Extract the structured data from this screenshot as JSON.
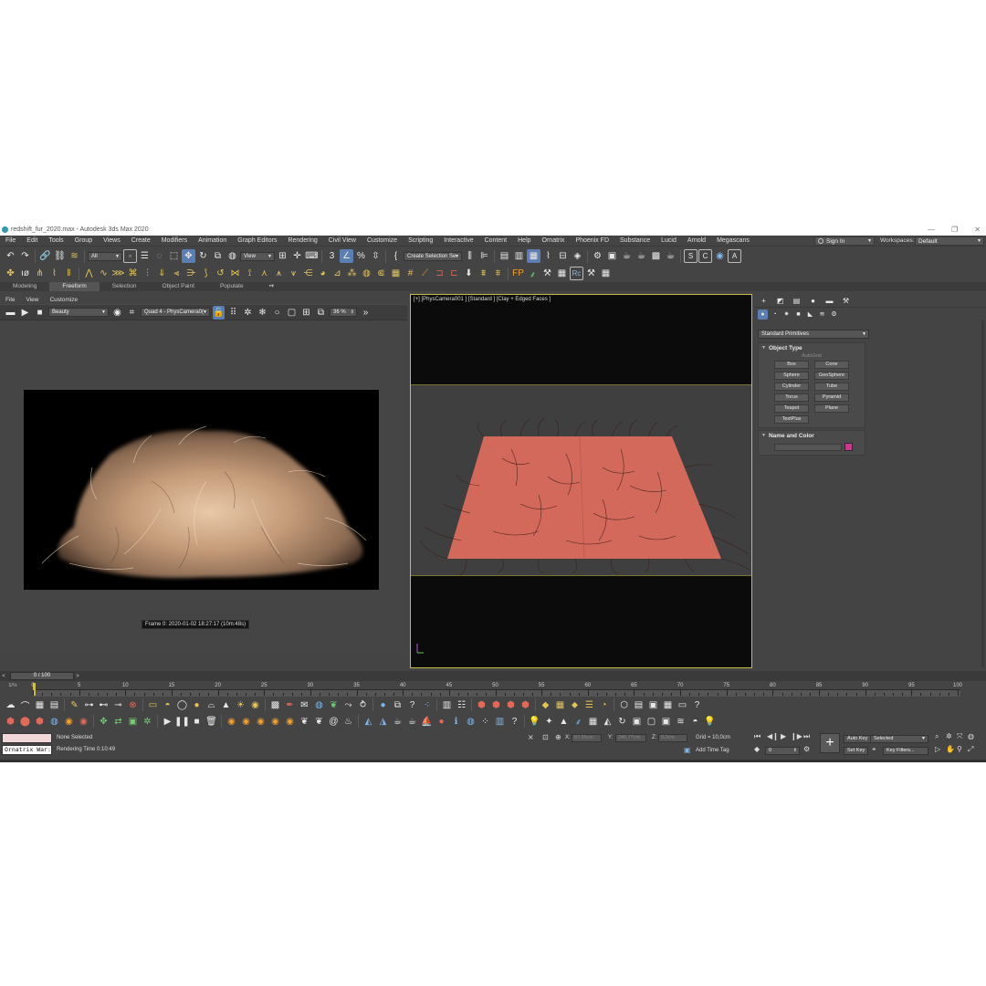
{
  "window": {
    "title": "redshift_fur_2020.max - Autodesk 3ds Max 2020",
    "controls": [
      "—",
      "❐",
      "✕"
    ]
  },
  "menubar": {
    "items": [
      "File",
      "Edit",
      "Tools",
      "Group",
      "Views",
      "Create",
      "Modifiers",
      "Animation",
      "Graph Editors",
      "Rendering",
      "Civil View",
      "Customize",
      "Scripting",
      "Interactive",
      "Content",
      "Help",
      "Ornatrix",
      "Phoenix FD",
      "Substance",
      "Lucid",
      "Arnold",
      "Megascans"
    ],
    "sign_in": "Sign In",
    "workspaces_label": "Workspaces:",
    "workspace_value": "Default"
  },
  "main_toolbar": {
    "filter_value": "All",
    "refcoord_value": "View",
    "selection_set_placeholder": "Create Selection Se"
  },
  "ribbon": {
    "tabs": [
      "Modeling",
      "Freeform",
      "Selection",
      "Object Paint",
      "Populate"
    ],
    "active": "Freeform"
  },
  "render_frame": {
    "menu": [
      "File",
      "View",
      "Customize"
    ],
    "channel_value": "Beauty",
    "view_value": "Quad 4 - PhysCamera0(",
    "zoom_value": "36 %",
    "frame_label": "Frame  0:  2020-01-02  18:27:17  (10m:48s)"
  },
  "viewport": {
    "label": "[+] [PhysCamera001 ] [Standard ] [Clay + Edged Faces ]"
  },
  "command_panel": {
    "category_value": "Standard Primitives",
    "object_type_title": "Object Type",
    "autogrid_label": "AutoGrid",
    "primitives": [
      "Box",
      "Cone",
      "Sphere",
      "GeoSphere",
      "Cylinder",
      "Tube",
      "Torus",
      "Pyramid",
      "Teapot",
      "Plane",
      "TextPlus"
    ],
    "name_color_title": "Name and Color",
    "swatch_color": "#c23c8b"
  },
  "timeline": {
    "counter": "0 / 100",
    "ticks": [
      "0",
      "5",
      "10",
      "15",
      "20",
      "25",
      "30",
      "35",
      "40",
      "45",
      "50",
      "55",
      "60",
      "65",
      "70",
      "75",
      "80",
      "85",
      "90",
      "95",
      "100"
    ],
    "frame_prefix": "1/½"
  },
  "status": {
    "selection": "None Selected",
    "rendering_time": "Rendering Time  0:10:49",
    "ornatrix_field": "Ornatrix War:",
    "x_label": "X:",
    "x_value": "67,55cm",
    "y_label": "Y:",
    "y_value": "246,77cm",
    "z_label": "Z:",
    "z_value": "0,0cm",
    "grid": "Grid = 10,0cm",
    "add_time_tag": "Add Time Tag",
    "auto_key": "Auto Key",
    "set_key": "Set Key",
    "key_mode_value": "Selected",
    "key_filters": "Key Filters...",
    "frame_value": "0"
  }
}
